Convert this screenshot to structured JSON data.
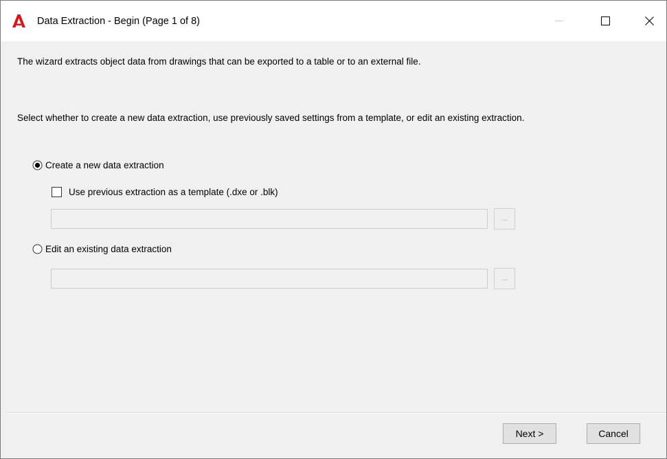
{
  "window": {
    "title": "Data Extraction - Begin (Page 1 of 8)",
    "icon": "autocad-a-icon",
    "accent_color": "#d3191c"
  },
  "content": {
    "intro_text": "The wizard extracts object data from drawings that can be exported to a table or to an external file.",
    "instruction_text": "Select whether to create a new data extraction, use previously saved settings from a template, or edit an existing extraction."
  },
  "options": {
    "create_new": {
      "label": "Create a new data extraction",
      "selected": true
    },
    "use_template": {
      "label": "Use previous extraction as a template (.dxe or .blk)",
      "checked": false,
      "path_value": "",
      "browse_label": "..."
    },
    "edit_existing": {
      "label": "Edit an existing data extraction",
      "selected": false,
      "path_value": "",
      "browse_label": "..."
    }
  },
  "footer": {
    "next_label": "Next >",
    "cancel_label": "Cancel"
  }
}
